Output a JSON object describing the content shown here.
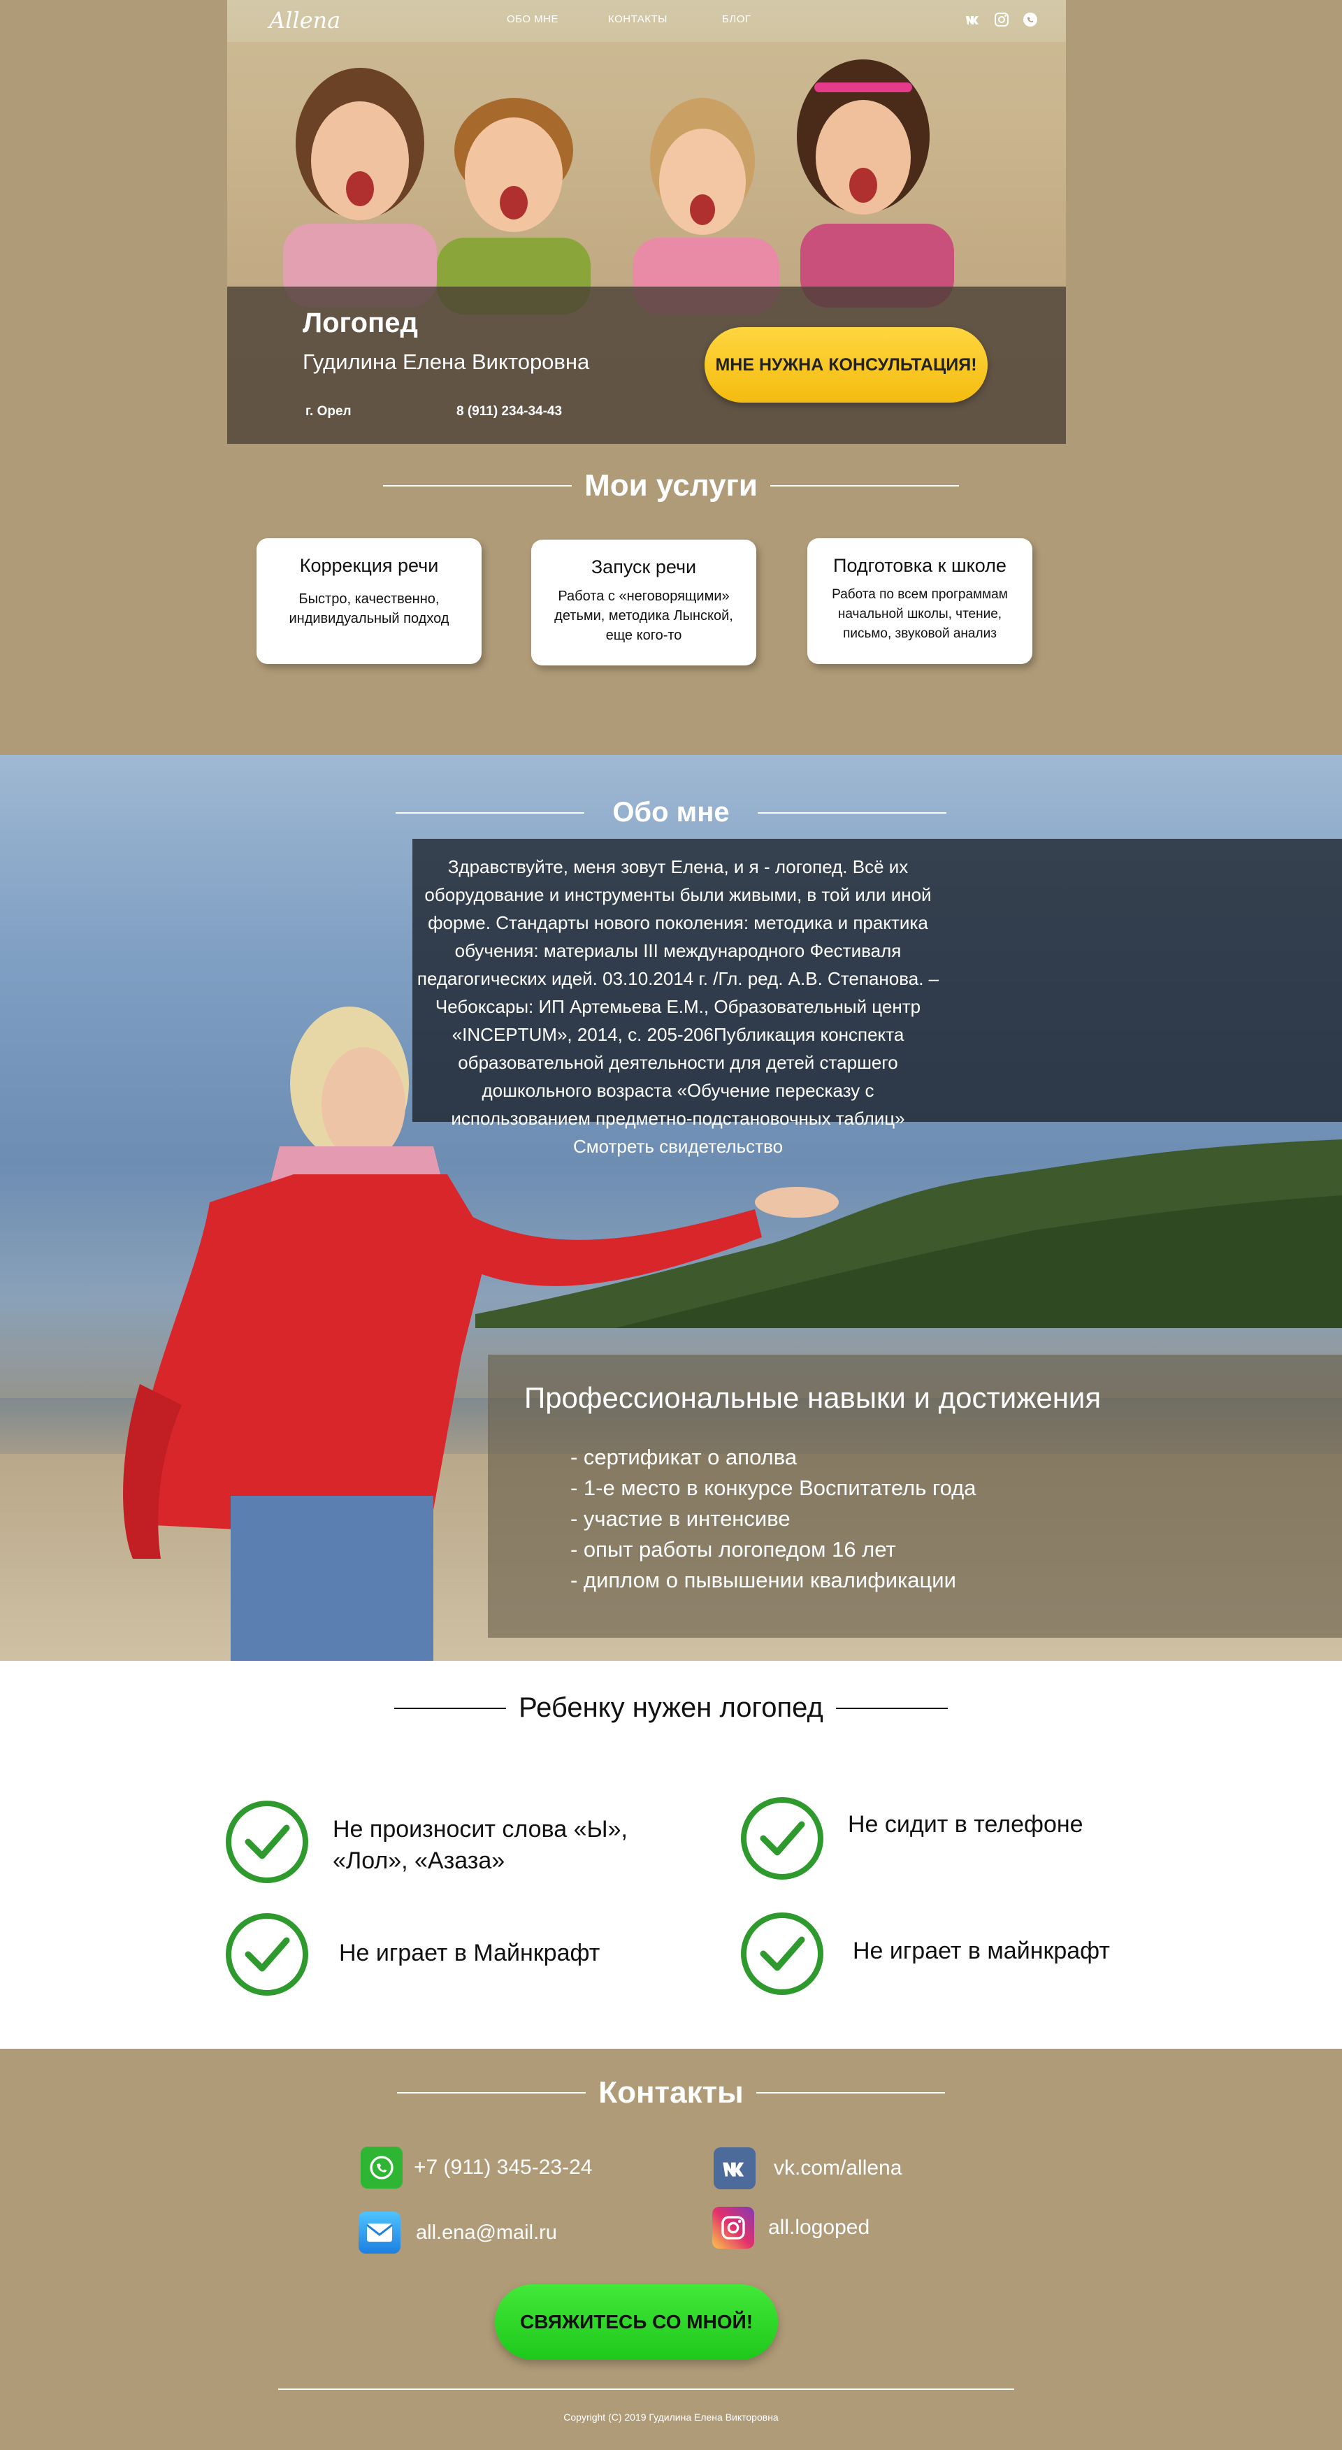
{
  "header": {
    "logo": "Allena",
    "nav": [
      "ОБО МНЕ",
      "КОНТАКТЫ",
      "БЛОГ"
    ],
    "social_icons": [
      "vk-icon",
      "instagram-icon",
      "whatsapp-icon"
    ]
  },
  "hero": {
    "title": "Логопед",
    "name": "Гудилина Елена Викторовна",
    "city": "г. Орел",
    "phone": "8 (911) 234-34-43",
    "cta": "МНЕ НУЖНА КОНСУЛЬТАЦИЯ!"
  },
  "services": {
    "title": "Мои услуги",
    "items": [
      {
        "title": "Коррекция речи",
        "text": "Быстро, качественно, индивидуальный подход"
      },
      {
        "title": "Запуск речи",
        "text": "Работа с «неговорящими» детьми, методика Лынской, еще кого-то"
      },
      {
        "title": "Подготовка к школе",
        "text": "Работа по всем программам начальной школы, чтение, письмо, звуковой анализ"
      }
    ]
  },
  "about": {
    "title": "Обо мне",
    "text": "Здравствуйте, меня зовут Елена, и я - логопед. Всё их оборудование и инструменты были живыми, в той или иной форме. Стандарты нового поколения: методика и практика обучения: материалы III международного Фестиваля педагогических идей. 03.10.2014 г. /Гл. ред. А.В. Степанова. – Чебоксары: ИП Артемьева Е.М., Образовательный центр «INCEPTUM», 2014, с. 205-206Публикация конспекта образовательной деятельности для детей старшего дошкольного возраста «Обучение пересказу с использованием предметно-подстановочных таблиц» Смотреть свидетельство"
  },
  "skills": {
    "title": "Профессиональные навыки и достижения",
    "items": [
      "- сертификат о аполва",
      "- 1-е место в конкурсе Воспитатель года",
      "- участие в интенсиве",
      "- опыт работы логопедом 16 лет",
      "- диплом о пывышении квалификации"
    ]
  },
  "needs": {
    "title": "Ребенку нужен логопед",
    "items": [
      "Не произносит слова «Ы», «Лол», «Азаза»",
      "Не сидит в телефоне",
      "Не играет в Майнкрафт",
      "Не играет в майнкрафт"
    ],
    "check_color": "#2e9a2e"
  },
  "contacts": {
    "title": "Контакты",
    "phone": "+7 (911) 345-23-24",
    "vk": "vk.com/allena",
    "email": "all.ena@mail.ru",
    "instagram": "all.logoped",
    "cta": "СВЯЖИТЕСЬ СО МНОЙ!",
    "copyright": "Copyright (C) 2019 Гудилина Елена Викторовна"
  },
  "colors": {
    "background": "#b09b78",
    "accent_yellow": "#f7c31b",
    "accent_green": "#2bd627"
  }
}
